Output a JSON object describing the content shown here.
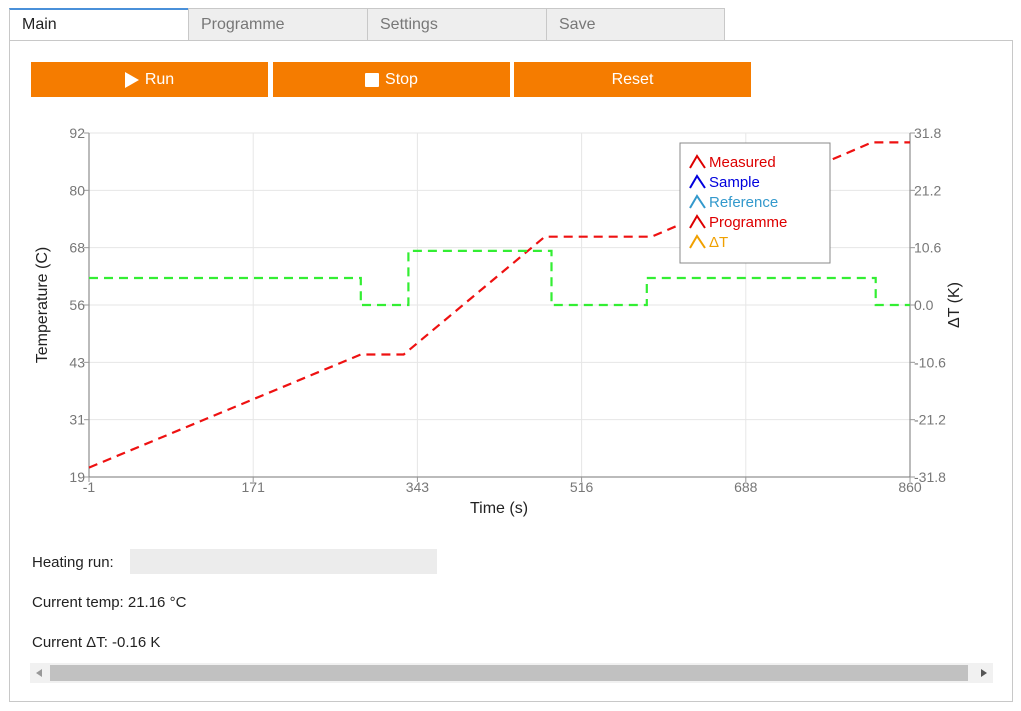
{
  "tabs": [
    {
      "label": "Main",
      "active": true
    },
    {
      "label": "Programme",
      "active": false
    },
    {
      "label": "Settings",
      "active": false
    },
    {
      "label": "Save",
      "active": false
    }
  ],
  "buttons": {
    "run_label": "Run",
    "stop_label": "Stop",
    "reset_label": "Reset",
    "color": "#f57c00"
  },
  "info": {
    "heating_run_label": "Heating run:",
    "heating_run_progress": 0,
    "current_temp": "Current temp: 21.16 °C",
    "current_dt": "Current ΔT: -0.16 K"
  },
  "chart_data": {
    "type": "line",
    "xlabel": "Time (s)",
    "ylabel_left": "Temperature (C)",
    "ylabel_right": "ΔT (K)",
    "x_ticks": [
      "-1",
      "171",
      "343",
      "516",
      "688",
      "860"
    ],
    "y_left_ticks": [
      "19",
      "31",
      "43",
      "56",
      "68",
      "80",
      "92"
    ],
    "y_right_ticks": [
      "-31.8",
      "-21.2",
      "-10.6",
      "0.0",
      "10.6",
      "21.2",
      "31.8"
    ],
    "xlim": [
      -1,
      860
    ],
    "ylim_left": [
      19,
      92
    ],
    "ylim_right": [
      -31.8,
      31.8
    ],
    "grid": true,
    "legend_position": "top-right",
    "legend": [
      {
        "name": "Measured",
        "color": "#dd0000"
      },
      {
        "name": "Sample",
        "color": "#0000dd"
      },
      {
        "name": "Reference",
        "color": "#3399cc"
      },
      {
        "name": "Programme",
        "color": "#dd0000"
      },
      {
        "name": "ΔT",
        "color": "#f0a000"
      }
    ],
    "series": [
      {
        "name": "Programme",
        "color": "#ee1111",
        "axis": "left",
        "x": [
          -1,
          284,
          329,
          477,
          589,
          820,
          860
        ],
        "y": [
          21.0,
          45.0,
          45.0,
          70.0,
          70.0,
          90.0,
          90.0
        ]
      },
      {
        "name": "ΔT",
        "color": "#33ee33",
        "axis": "right",
        "x": [
          -1,
          284,
          284,
          334,
          334,
          484,
          484,
          584,
          584,
          824,
          824,
          860
        ],
        "y": [
          5.0,
          5.0,
          0.0,
          0.0,
          10.0,
          10.0,
          0.0,
          0.0,
          5.0,
          5.0,
          0.0,
          0.0
        ]
      }
    ]
  }
}
